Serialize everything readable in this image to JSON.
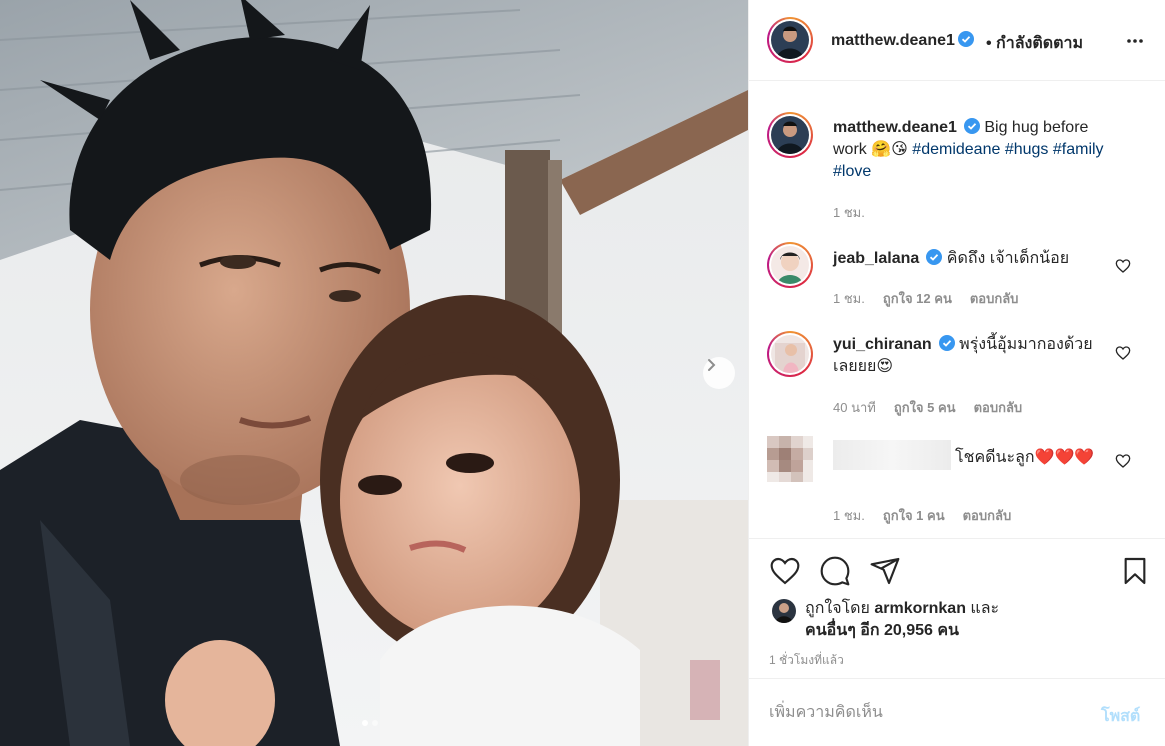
{
  "post": {
    "photo_alt": "selfie of man and child",
    "carousel": {
      "count": 2,
      "active": 1
    }
  },
  "header": {
    "username": "matthew.deane1",
    "follow_state": "• กำลังติดตาม",
    "verified_icon": "verified-badge-icon",
    "more_icon": "more-options-icon"
  },
  "caption": {
    "username": "matthew.deane1",
    "text_before": "Big hug before work",
    "emoji": "🤗😘",
    "hashtags": [
      "#demideane",
      "#hugs",
      "#family",
      "#love"
    ],
    "time": "1 ชม."
  },
  "comments": [
    {
      "username": "jeab_lalana",
      "text": "คิดถึง เจ้าเด็กน้อย",
      "time": "1 ชม.",
      "likes": "ถูกใจ 12 คน",
      "reply": "ตอบกลับ"
    },
    {
      "username": "yui_chiranan",
      "text": "พรุ่งนี้อุ้มมากองด้วยเลยยย😍",
      "time": "40 นาที",
      "likes": "ถูกใจ 5 คน",
      "reply": "ตอบกลับ"
    },
    {
      "username": "",
      "text": "โชคดีนะลูก❤️❤️❤️",
      "time": "1 ชม.",
      "likes": "ถูกใจ 1 คน",
      "reply": "ตอบกลับ"
    }
  ],
  "likes": {
    "prefix": "ถูกใจโดย",
    "user": "armkornkan",
    "and": "และ",
    "others": "คนอื่นๆ อีก 20,956 คน"
  },
  "timestamp": "1 ชั่วโมงที่แล้ว",
  "add_comment": {
    "placeholder": "เพิ่มความคิดเห็น",
    "post_label": "โพสต์"
  },
  "colors": {
    "verified": "#3897f0",
    "hashtag": "#00376b",
    "muted": "#8e8e8e",
    "post_disabled": "#b2dffc",
    "heart_red": "#e0245e"
  }
}
